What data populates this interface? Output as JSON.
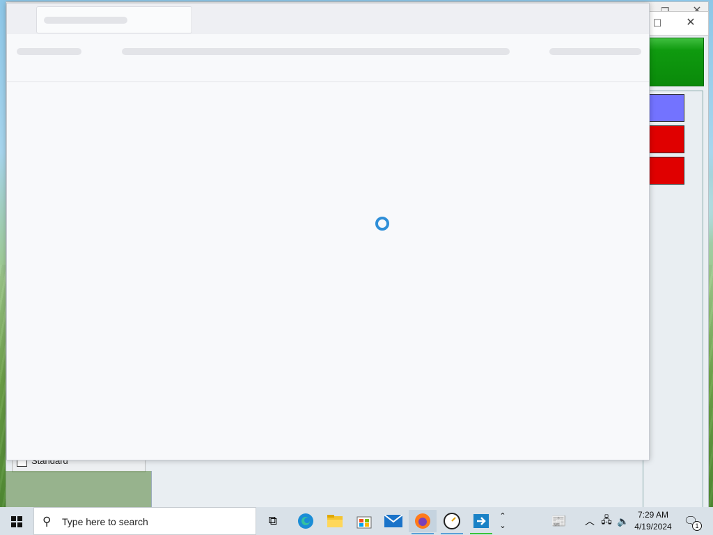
{
  "desktop": {
    "background_checkbox_label": "Standard",
    "swatch_colors": [
      "#7373ff",
      "#e00000",
      "#e00000"
    ],
    "accent_green": "#0f9a0f"
  },
  "loading_window": {
    "state": "loading",
    "spinner_color": "#2f8fd8"
  },
  "taskbar": {
    "search_placeholder": "Type here to search",
    "pinned_icons": [
      "task-view-icon",
      "edge-icon",
      "file-explorer-icon",
      "store-icon",
      "mail-icon",
      "firefox-icon",
      "clock-app-icon",
      "remote-app-icon"
    ],
    "time": "7:29 AM",
    "date": "4/19/2024",
    "notification_count": "1"
  }
}
